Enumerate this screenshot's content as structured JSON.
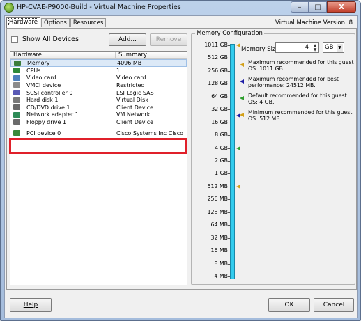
{
  "window": {
    "title": "HP-CVAE-P9000-Build - Virtual Machine Properties",
    "minimize_glyph": "–",
    "maximize_glyph": "□",
    "close_glyph": "X"
  },
  "tabs": [
    "Hardware",
    "Options",
    "Resources"
  ],
  "active_tab": "Hardware",
  "vm_version": "Virtual Machine Version: 8",
  "hardware": {
    "show_all_label": "Show All Devices",
    "add_label": "Add...",
    "remove_label": "Remove",
    "col_hardware": "Hardware",
    "col_summary": "Summary",
    "rows": [
      {
        "name": "Memory",
        "summary": "4096 MB",
        "icon": "memory-icon",
        "color": "#3b7d3b"
      },
      {
        "name": "CPUs",
        "summary": "1",
        "icon": "cpu-icon",
        "color": "#2f8a3a"
      },
      {
        "name": "Video card",
        "summary": "Video card",
        "icon": "monitor-icon",
        "color": "#4f81bd"
      },
      {
        "name": "VMCI device",
        "summary": "Restricted",
        "icon": "vmci-device-icon",
        "color": "#8c8c8c"
      },
      {
        "name": "SCSI controller 0",
        "summary": "LSI Logic SAS",
        "icon": "scsi-controller-icon",
        "color": "#5a5ab5"
      },
      {
        "name": "Hard disk 1",
        "summary": "Virtual Disk",
        "icon": "hard-disk-icon",
        "color": "#7a7a7a"
      },
      {
        "name": "CD/DVD drive 1",
        "summary": "Client Device",
        "icon": "cd-dvd-icon",
        "color": "#6b6b6b"
      },
      {
        "name": "Network adapter 1",
        "summary": "VM Network",
        "icon": "network-adapter-icon",
        "color": "#2e8b57"
      },
      {
        "name": "Floppy drive 1",
        "summary": "Client Device",
        "icon": "floppy-icon",
        "color": "#6b6b6b"
      },
      {
        "name": "PCI device 0",
        "summary": "Cisco Systems Inc Cisco",
        "icon": "pci-device-icon",
        "color": "#3a8a3a"
      }
    ],
    "selected": "Memory",
    "highlighted": "PCI device 0",
    "highlight_color": "#e0202a"
  },
  "memory": {
    "group_label": "Memory Configuration",
    "size_label": "Memory Size:",
    "size_value": "4",
    "unit": "GB",
    "scale_labels": [
      "1011 GB",
      "512 GB",
      "256 GB",
      "128 GB",
      "64 GB",
      "32 GB",
      "16 GB",
      "8 GB",
      "4 GB",
      "2 GB",
      "1 GB",
      "512 MB",
      "256 MB",
      "128 MB",
      "64 MB",
      "32 MB",
      "16 MB",
      "8 MB",
      "4 MB"
    ],
    "bar_color": "#33ccee",
    "recommendations": [
      {
        "text": "Maximum recommended for this guest OS: 1011 GB.",
        "color": "#d4a017",
        "icon": "max-recommended-icon"
      },
      {
        "text": "Maximum recommended for best performance: 24512 MB.",
        "color": "#1a1aa6",
        "icon": "best-performance-icon"
      },
      {
        "text": "Default recommended for this guest OS: 4 GB.",
        "color": "#2e9e2e",
        "icon": "default-recommended-icon"
      },
      {
        "text": "Minimum recommended for this guest OS: 512 MB.",
        "color": "#d4a017",
        "icon": "min-recommended-icon"
      }
    ]
  },
  "footer": {
    "help_label": "Help",
    "ok_label": "OK",
    "cancel_label": "Cancel"
  }
}
